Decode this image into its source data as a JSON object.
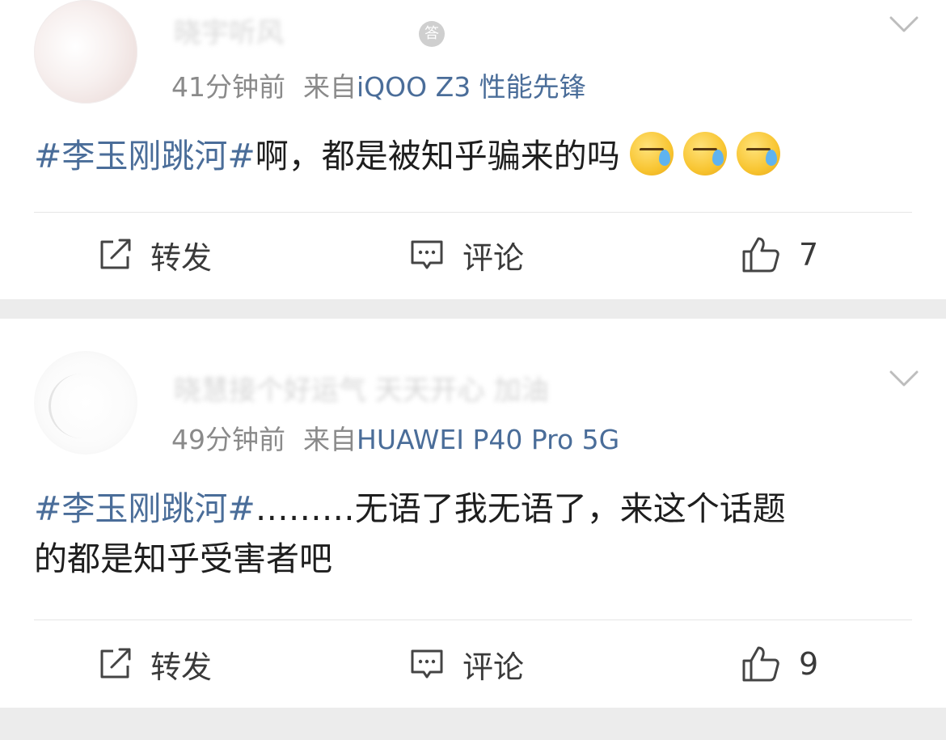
{
  "posts": [
    {
      "username": "晓宇听风",
      "badge": "答",
      "time": "41分钟前",
      "from_label": "来自",
      "device": "iQOO Z3 性能先锋",
      "hashtag": "#李玉刚跳河#",
      "text": "啊，都是被知乎骗来的吗",
      "emojis": [
        "sweat-face",
        "sweat-face",
        "sweat-face"
      ],
      "actions": {
        "repost": "转发",
        "comment": "评论",
        "likes": "7"
      }
    },
    {
      "username": "晓慧接个好运气 天天开心 加油",
      "time": "49分钟前",
      "from_label": "来自",
      "device": "HUAWEI P40 Pro 5G",
      "hashtag": "#李玉刚跳河#",
      "text_line1": "………无语了我无语了，来这个话题",
      "text_line2": "的都是知乎受害者吧",
      "actions": {
        "repost": "转发",
        "comment": "评论",
        "likes": "9"
      }
    }
  ],
  "colors": {
    "link": "#4a6d99",
    "meta": "#8a8a8a",
    "separator": "#ececec"
  }
}
